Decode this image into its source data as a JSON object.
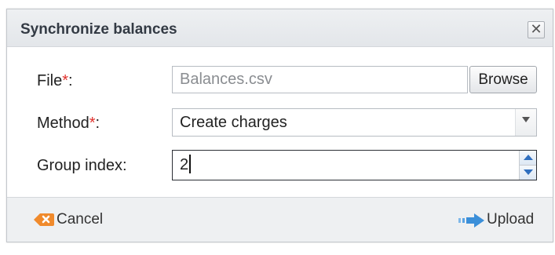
{
  "dialog": {
    "title": "Synchronize balances",
    "close_label": "✕"
  },
  "form": {
    "file": {
      "label": "File",
      "required_mark": "*",
      "suffix": ":",
      "value": "Balances.csv",
      "browse_label": "Browse"
    },
    "method": {
      "label": "Method",
      "required_mark": "*",
      "suffix": ":",
      "selected": "Create charges"
    },
    "group_index": {
      "label": "Group index:",
      "value": "2"
    }
  },
  "footer": {
    "cancel_label": "Cancel",
    "upload_label": "Upload"
  },
  "colors": {
    "required": "#e0312c",
    "cancel_icon": "#f08a2c",
    "upload_icon": "#3b8fd9",
    "spinner_arrow": "#2f6fbf"
  }
}
